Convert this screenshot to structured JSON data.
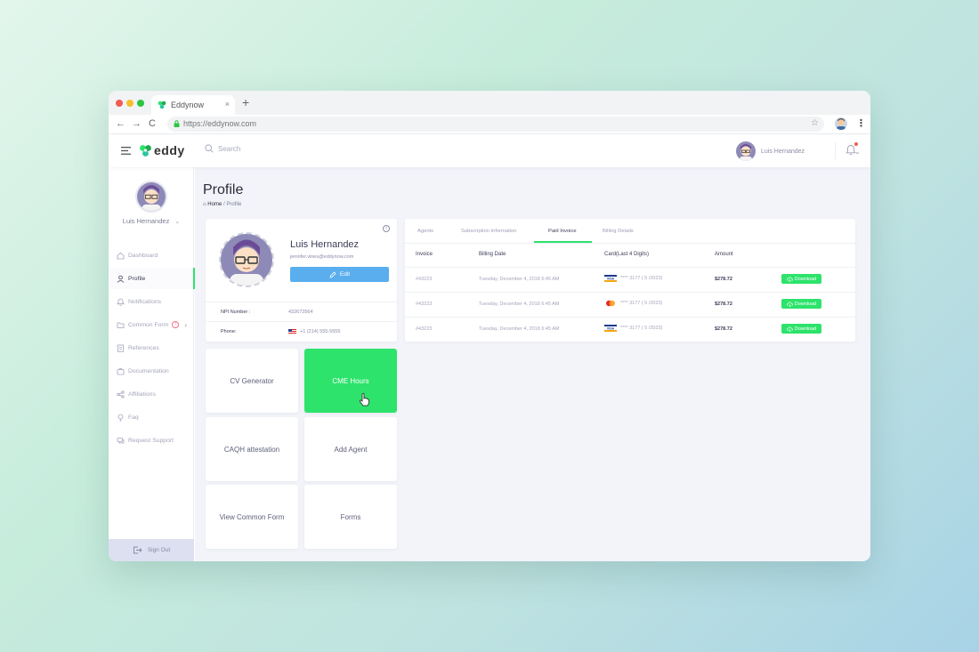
{
  "browser": {
    "tab_title": "Eddynow",
    "tab_close": "×",
    "new_tab": "+",
    "url": "https://eddynow.com",
    "back": "←",
    "forward": "→",
    "reload": "C",
    "star": "☆",
    "menu": "⋮"
  },
  "header": {
    "logo_text": "eddy",
    "search_placeholder": "Search",
    "user_name": "Luis Hernandez",
    "caret": "⌄"
  },
  "sidebar": {
    "user_name": "Luis Hernandez",
    "caret": "⌄",
    "items": [
      {
        "label": "Dashboard",
        "icon": "home-icon"
      },
      {
        "label": "Profile",
        "icon": "user-icon"
      },
      {
        "label": "Notifications",
        "icon": "bell-icon"
      },
      {
        "label": "Common Form",
        "icon": "folder-icon",
        "badge": "!",
        "chevron": "›"
      },
      {
        "label": "References",
        "icon": "document-icon"
      },
      {
        "label": "Documentation",
        "icon": "briefcase-icon"
      },
      {
        "label": "Affiliations",
        "icon": "share-icon"
      },
      {
        "label": "Faq",
        "icon": "bulb-icon"
      },
      {
        "label": "Request Support",
        "icon": "chat-icon"
      }
    ],
    "sign_out": "Sign Out"
  },
  "page": {
    "title": "Profile",
    "breadcrumb_home": "Home",
    "breadcrumb_sep": " / ",
    "breadcrumb_current": "Profile"
  },
  "profile": {
    "name": "Luis Hernandez",
    "email": "jennifer.vines@eddynow.com",
    "edit_label": "Edit",
    "info_icon": "i",
    "npi_label": "NPI Number :",
    "npi_value": "432673564",
    "phone_label": "Phone:",
    "phone_value": "+1 (214) 555-5555"
  },
  "tiles": [
    {
      "label": "CV Generator"
    },
    {
      "label": "CME Hours"
    },
    {
      "label": "CAQH attestation"
    },
    {
      "label": "Add Agent"
    },
    {
      "label": "View Common Form"
    },
    {
      "label": "Forms"
    }
  ],
  "invoice": {
    "tabs": [
      "Agents",
      "Subscription Information",
      "Paid Invoice",
      "Billing Details"
    ],
    "active_tab": "Paid Invoice",
    "columns": [
      "Invoice",
      "Billing Date",
      "Card(Last 4 Digits)",
      "Amount"
    ],
    "rows": [
      {
        "invoice": "#43223",
        "date": "Tuesday, December 4, 2018 6:45 AM",
        "card_brand": "visa",
        "card": "**** 3177 ( 5 /2023)",
        "amount": "$278.72",
        "action": "Download"
      },
      {
        "invoice": "#43223",
        "date": "Tuesday, December 4, 2018 6:45 AM",
        "card_brand": "mastercard",
        "card": "**** 3177 ( 5 /2023)",
        "amount": "$278.72",
        "action": "Download"
      },
      {
        "invoice": "#43223",
        "date": "Tuesday, December 4, 2018 6:45 AM",
        "card_brand": "visa",
        "card": "**** 3177 ( 5 /2023)",
        "amount": "$278.72",
        "action": "Download"
      }
    ]
  },
  "colors": {
    "accent_green": "#2de36b",
    "edit_blue": "#5aaeee",
    "page_bg": "#f3f4f9",
    "sidebar_signout_bg": "#dde0f0"
  }
}
